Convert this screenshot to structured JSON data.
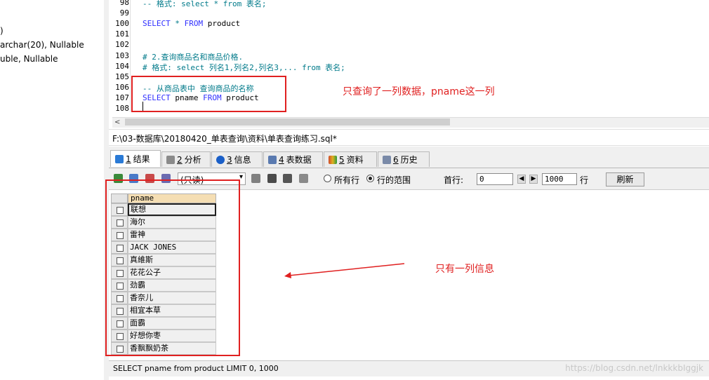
{
  "schema_pane": {
    "lines": [
      ")",
      "archar(20), Nullable",
      "uble, Nullable"
    ]
  },
  "editor": {
    "lines": [
      {
        "num": "98",
        "parts": [
          {
            "t": "-- 格式: select * from 表名;",
            "c": "c-cm"
          }
        ]
      },
      {
        "num": "99",
        "parts": []
      },
      {
        "num": "100",
        "parts": [
          {
            "t": "SELECT",
            "c": "c-kw"
          },
          {
            "t": " ",
            "c": "c-id"
          },
          {
            "t": "*",
            "c": "c-cm"
          },
          {
            "t": " ",
            "c": "c-id"
          },
          {
            "t": "FROM",
            "c": "c-kw"
          },
          {
            "t": " product",
            "c": "c-id"
          }
        ]
      },
      {
        "num": "101",
        "parts": []
      },
      {
        "num": "102",
        "parts": []
      },
      {
        "num": "103",
        "parts": [
          {
            "t": "# 2.查询商品名和商品价格.",
            "c": "c-cm"
          }
        ]
      },
      {
        "num": "104",
        "parts": [
          {
            "t": "# 格式: select 列名1,列名2,列名3,... from 表名;",
            "c": "c-cm"
          }
        ]
      },
      {
        "num": "105",
        "parts": []
      },
      {
        "num": "106",
        "parts": [
          {
            "t": "-- 从商品表中 查询商品的名称",
            "c": "c-cm"
          }
        ]
      },
      {
        "num": "107",
        "parts": [
          {
            "t": "SELECT",
            "c": "c-kw"
          },
          {
            "t": " pname ",
            "c": "c-id"
          },
          {
            "t": "FROM",
            "c": "c-kw"
          },
          {
            "t": " product",
            "c": "c-id"
          }
        ]
      },
      {
        "num": "108",
        "parts": []
      }
    ]
  },
  "file_path": "F:\\03-数据库\\20180420_单表查询\\资料\\单表查询练习.sql*",
  "tabs": [
    {
      "num": "1",
      "label": "结果",
      "color": "#2a7ad6"
    },
    {
      "num": "2",
      "label": "分析",
      "color": "#8a8a8a"
    },
    {
      "num": "3",
      "label": "信息",
      "color": "#1a5fc8"
    },
    {
      "num": "4",
      "label": "表数据",
      "color": "#5a7ab0"
    },
    {
      "num": "5",
      "label": "资料",
      "color": "#d04a2a"
    },
    {
      "num": "6",
      "label": "历史",
      "color": "#7a8aa8"
    }
  ],
  "toolbar": {
    "mode_select": "(只读)",
    "radio_all": "所有行",
    "radio_range": "行的范围",
    "first_row_label": "首行:",
    "first_row_value": "0",
    "rows_value": "1000",
    "rows_suffix": "行",
    "refresh": "刷新"
  },
  "grid": {
    "column": "pname",
    "rows": [
      "联想",
      "海尔",
      "雷神",
      "JACK JONES",
      "真維斯",
      "花花公子",
      "劲霸",
      "香奈儿",
      "相宜本草",
      "面霸",
      "好想你枣",
      "香飘飘奶茶"
    ]
  },
  "status_text": "SELECT pname from product  LIMIT 0, 1000",
  "watermark": "https://blog.csdn.net/lnkkkbIggjk",
  "annotations": {
    "note1": "只查询了一列数据，pname这一列",
    "note2": "只有一列信息"
  },
  "colors": {
    "accent_red": "#e02020",
    "keyword_blue": "#3030ff",
    "comment_teal": "#007a8a"
  }
}
